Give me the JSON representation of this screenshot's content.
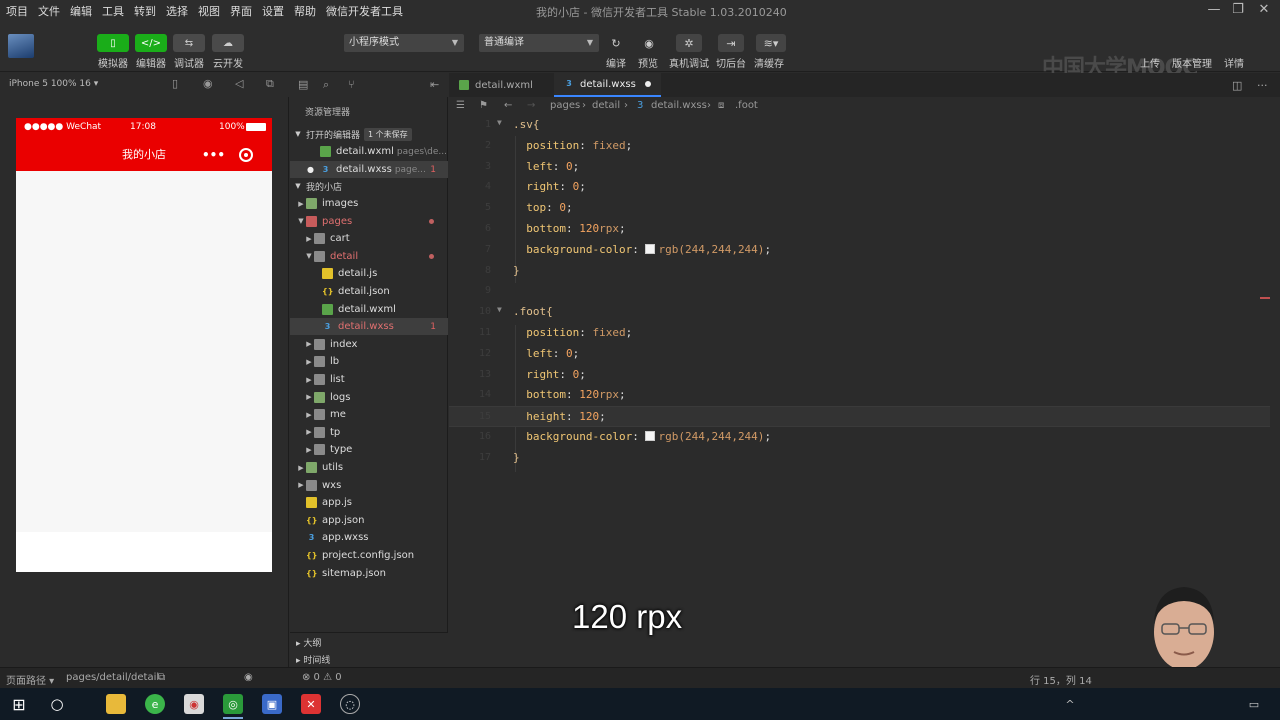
{
  "menubar": {
    "items": [
      "项目",
      "文件",
      "编辑",
      "工具",
      "转到",
      "选择",
      "视图",
      "界面",
      "设置",
      "帮助",
      "微信开发者工具"
    ],
    "window_title": "我的小店 - 微信开发者工具 Stable 1.03.2010240"
  },
  "toolbar": {
    "mode_buttons": [
      {
        "label": "模拟器",
        "icon": "phone-icon"
      },
      {
        "label": "编辑器",
        "icon": "code-icon"
      },
      {
        "label": "调试器",
        "icon": "debug-icon"
      },
      {
        "label": "云开发",
        "icon": "cloud-icon"
      }
    ],
    "mode_select": "小程序模式",
    "compile_select": "普通编译",
    "actions": [
      {
        "label": "编译",
        "icon": "refresh-icon"
      },
      {
        "label": "预览",
        "icon": "eye-icon"
      },
      {
        "label": "真机调试",
        "icon": "bug-icon"
      },
      {
        "label": "切后台",
        "icon": "switch-icon"
      },
      {
        "label": "清缓存",
        "icon": "layers-icon"
      }
    ],
    "watermark": "中国大学MOOC",
    "right_actions": [
      "上传",
      "版本管理",
      "详情"
    ]
  },
  "simulator": {
    "device": "iPhone 5 100% 16 ▾",
    "status_left": "●●●●● WeChat",
    "status_time": "17:08",
    "status_battery": "100%",
    "page_title": "我的小店",
    "capsule_dots": "•••"
  },
  "explorer": {
    "title": "资源管理器",
    "open_editors_label": "打开的编辑器",
    "unsaved_badge": "1 个未保存",
    "open_files": [
      {
        "name": "detail.wxml",
        "hint": "pages\\de...",
        "type": "wxml"
      },
      {
        "name": "detail.wxss",
        "hint": "page...",
        "type": "wxss",
        "mod": "1"
      }
    ],
    "project_label": "我的小店",
    "tree": [
      {
        "name": "images",
        "type": "folder-special",
        "depth": 1
      },
      {
        "name": "pages",
        "type": "folder-pages",
        "depth": 1,
        "open": true
      },
      {
        "name": "cart",
        "type": "folder",
        "depth": 2
      },
      {
        "name": "detail",
        "type": "folder",
        "depth": 2,
        "open": true
      },
      {
        "name": "detail.js",
        "type": "js",
        "depth": 3
      },
      {
        "name": "detail.json",
        "type": "json",
        "depth": 3
      },
      {
        "name": "detail.wxml",
        "type": "wxml",
        "depth": 3
      },
      {
        "name": "detail.wxss",
        "type": "wxss",
        "depth": 3,
        "mod": "1"
      },
      {
        "name": "index",
        "type": "folder",
        "depth": 2
      },
      {
        "name": "lb",
        "type": "folder",
        "depth": 2
      },
      {
        "name": "list",
        "type": "folder",
        "depth": 2
      },
      {
        "name": "logs",
        "type": "folder-special",
        "depth": 2
      },
      {
        "name": "me",
        "type": "folder",
        "depth": 2
      },
      {
        "name": "tp",
        "type": "folder",
        "depth": 2
      },
      {
        "name": "type",
        "type": "folder",
        "depth": 2
      },
      {
        "name": "utils",
        "type": "folder-special",
        "depth": 1
      },
      {
        "name": "wxs",
        "type": "folder",
        "depth": 1
      },
      {
        "name": "app.js",
        "type": "js",
        "depth": 1
      },
      {
        "name": "app.json",
        "type": "json",
        "depth": 1
      },
      {
        "name": "app.wxss",
        "type": "wxss",
        "depth": 1
      },
      {
        "name": "project.config.json",
        "type": "json",
        "depth": 1
      },
      {
        "name": "sitemap.json",
        "type": "json",
        "depth": 1
      }
    ],
    "outline_label": "大纲",
    "timeline_label": "时间线"
  },
  "editor": {
    "tabs": [
      {
        "name": "detail.wxml",
        "type": "wxml",
        "active": false
      },
      {
        "name": "detail.wxss",
        "type": "wxss",
        "active": true
      }
    ],
    "breadcrumb": [
      "pages",
      "detail",
      "detail.wxss",
      ".foot"
    ],
    "lines": [
      {
        "n": "1",
        "tokens": [
          {
            "t": ".sv{",
            "c": "sel-c"
          }
        ]
      },
      {
        "n": "2",
        "tokens": [
          {
            "t": "  position",
            "c": "prop"
          },
          {
            "t": ": ",
            "c": "punc"
          },
          {
            "t": "fixed",
            "c": "val"
          },
          {
            "t": ";",
            "c": "punc"
          }
        ]
      },
      {
        "n": "3",
        "tokens": [
          {
            "t": "  left",
            "c": "prop"
          },
          {
            "t": ": ",
            "c": "punc"
          },
          {
            "t": "0",
            "c": "num"
          },
          {
            "t": ";",
            "c": "punc"
          }
        ]
      },
      {
        "n": "4",
        "tokens": [
          {
            "t": "  right",
            "c": "prop"
          },
          {
            "t": ": ",
            "c": "punc"
          },
          {
            "t": "0",
            "c": "num"
          },
          {
            "t": ";",
            "c": "punc"
          }
        ]
      },
      {
        "n": "5",
        "tokens": [
          {
            "t": "  top",
            "c": "prop"
          },
          {
            "t": ": ",
            "c": "punc"
          },
          {
            "t": "0",
            "c": "num"
          },
          {
            "t": ";",
            "c": "punc"
          }
        ]
      },
      {
        "n": "6",
        "tokens": [
          {
            "t": "  bottom",
            "c": "prop"
          },
          {
            "t": ": ",
            "c": "punc"
          },
          {
            "t": "120",
            "c": "num"
          },
          {
            "t": "rpx",
            "c": "val"
          },
          {
            "t": ";",
            "c": "punc"
          }
        ]
      },
      {
        "n": "7",
        "tokens": [
          {
            "t": "  background-color",
            "c": "prop"
          },
          {
            "t": ": ",
            "c": "punc"
          },
          {
            "t": "SWATCH",
            "c": "swatch"
          },
          {
            "t": "rgb(244,244,244)",
            "c": "val"
          },
          {
            "t": ";",
            "c": "punc"
          }
        ]
      },
      {
        "n": "8",
        "tokens": [
          {
            "t": "}",
            "c": "sel-c"
          }
        ]
      },
      {
        "n": "9",
        "tokens": []
      },
      {
        "n": "10",
        "tokens": [
          {
            "t": ".foot{",
            "c": "sel-c"
          }
        ]
      },
      {
        "n": "11",
        "tokens": [
          {
            "t": "  position",
            "c": "prop"
          },
          {
            "t": ": ",
            "c": "punc"
          },
          {
            "t": "fixed",
            "c": "val"
          },
          {
            "t": ";",
            "c": "punc"
          }
        ]
      },
      {
        "n": "12",
        "tokens": [
          {
            "t": "  left",
            "c": "prop"
          },
          {
            "t": ": ",
            "c": "punc"
          },
          {
            "t": "0",
            "c": "num"
          },
          {
            "t": ";",
            "c": "punc"
          }
        ]
      },
      {
        "n": "13",
        "tokens": [
          {
            "t": "  right",
            "c": "prop"
          },
          {
            "t": ": ",
            "c": "punc"
          },
          {
            "t": "0",
            "c": "num"
          },
          {
            "t": ";",
            "c": "punc"
          }
        ]
      },
      {
        "n": "14",
        "tokens": [
          {
            "t": "  bottom",
            "c": "prop"
          },
          {
            "t": ": ",
            "c": "punc"
          },
          {
            "t": "120",
            "c": "num"
          },
          {
            "t": "rpx",
            "c": "val"
          },
          {
            "t": ";",
            "c": "punc"
          }
        ]
      },
      {
        "n": "15",
        "tokens": [
          {
            "t": "  height",
            "c": "prop"
          },
          {
            "t": ": ",
            "c": "punc"
          },
          {
            "t": "120",
            "c": "num"
          },
          {
            "t": ";",
            "c": "punc"
          }
        ],
        "current": true
      },
      {
        "n": "16",
        "tokens": [
          {
            "t": "  background-color",
            "c": "prop"
          },
          {
            "t": ": ",
            "c": "punc"
          },
          {
            "t": "SWATCH",
            "c": "swatch"
          },
          {
            "t": "rgb(244,244,244)",
            "c": "val"
          },
          {
            "t": ";",
            "c": "punc"
          }
        ]
      },
      {
        "n": "17",
        "tokens": [
          {
            "t": "}",
            "c": "sel-c"
          }
        ]
      }
    ]
  },
  "statusbar": {
    "path_label": "页面路径 ▾",
    "path_value": "pages/detail/detail",
    "problems": "⊗ 0 ⚠ 0",
    "cursor": "行 15，列 14"
  },
  "subtitle": "120 rpx",
  "colors": {
    "accent_green": "#1aad19",
    "nav_red": "#ea0000",
    "editor_bg": "#2b2b2b"
  }
}
